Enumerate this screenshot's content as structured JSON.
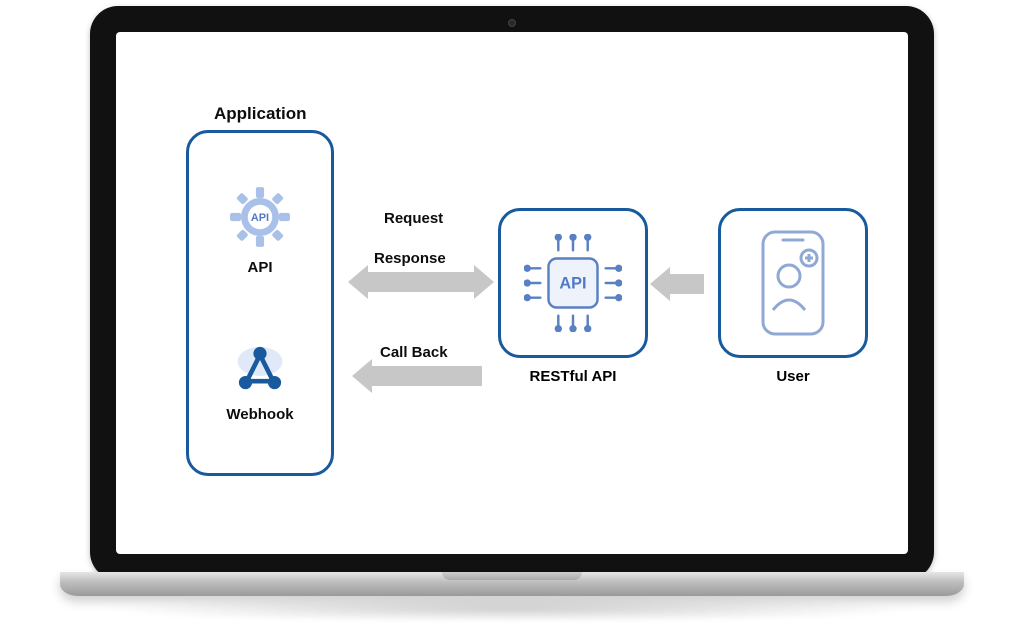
{
  "diagram": {
    "title": "Application",
    "application": {
      "api_label": "API",
      "api_icon_text": "API",
      "webhook_label": "Webhook"
    },
    "restful": {
      "label": "RESTful API",
      "icon_text": "API"
    },
    "user": {
      "label": "User"
    },
    "flows": {
      "request": "Request",
      "response": "Response",
      "callback": "Call Back"
    }
  },
  "colors": {
    "box_border": "#185a9d",
    "accent_light": "#a9c1e8",
    "arrow": "#c7c7c7"
  }
}
